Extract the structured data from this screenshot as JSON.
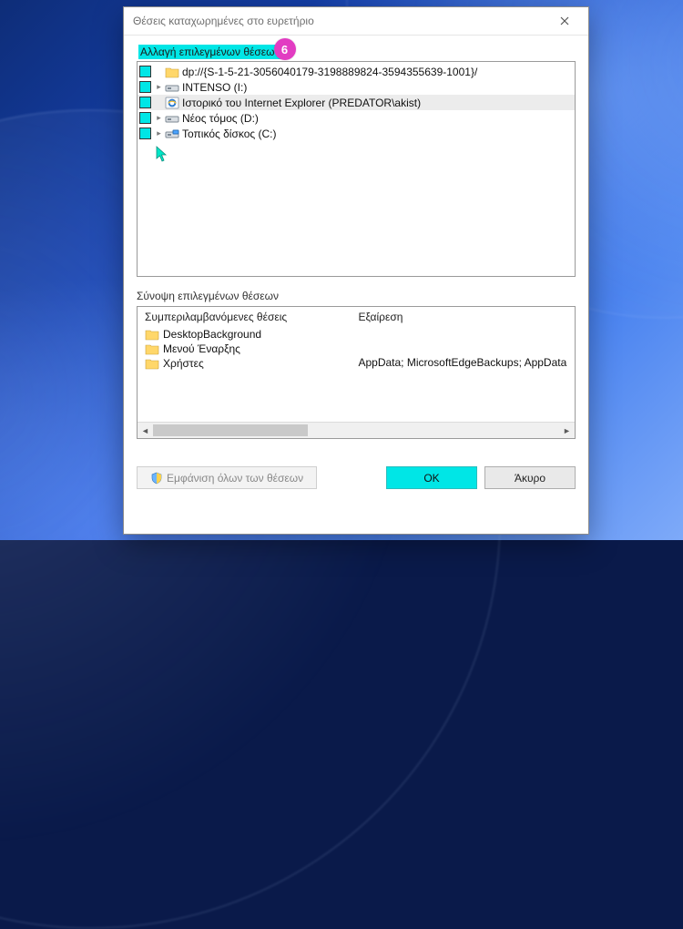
{
  "dialog": {
    "title": "Θέσεις καταχωρημένες στο ευρετήριο"
  },
  "tree": {
    "header": "Αλλαγή επιλεγμένων θέσεων",
    "badge": "6",
    "items": [
      {
        "icon": "folder",
        "label": "dp://{S-1-5-21-3056040179-3198889824-3594355639-1001}/",
        "expand": "none",
        "selected": false
      },
      {
        "icon": "drive",
        "label": "INTENSO (I:)",
        "expand": "closed",
        "selected": false
      },
      {
        "icon": "ie",
        "label": "Ιστορικό του Internet Explorer (PREDATOR\\akist)",
        "expand": "none",
        "selected": true
      },
      {
        "icon": "drive",
        "label": "Νέος τόμος (D:)",
        "expand": "closed",
        "selected": false
      },
      {
        "icon": "drive-c",
        "label": "Τοπικός δίσκος (C:)",
        "expand": "closed",
        "selected": false
      }
    ]
  },
  "summary": {
    "header": "Σύνοψη επιλεγμένων θέσεων",
    "included_header": "Συμπεριλαμβανόμενες θέσεις",
    "excluded_header": "Εξαίρεση",
    "included": [
      "DesktopBackground",
      "Μενού Έναρξης",
      "Χρήστες"
    ],
    "excluded_line": "AppData; MicrosoftEdgeBackups; AppData"
  },
  "buttons": {
    "show_all": "Εμφάνιση όλων των θέσεων",
    "ok": "OK",
    "cancel": "Άκυρο"
  }
}
